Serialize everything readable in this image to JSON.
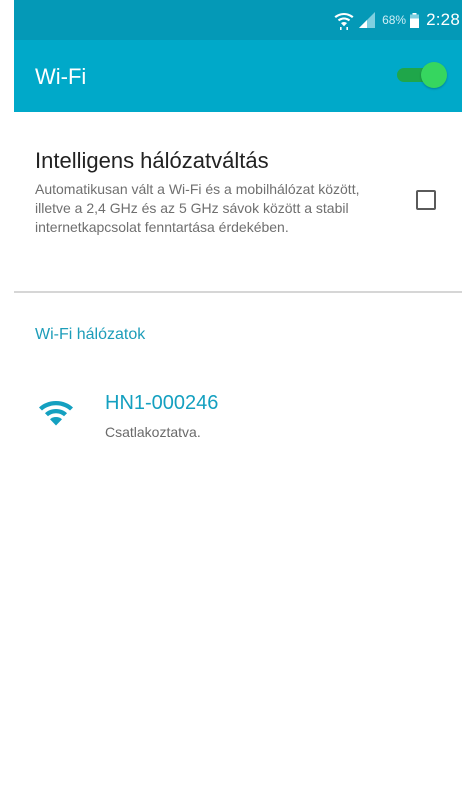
{
  "status_bar": {
    "battery_percent": "68%",
    "time": "2:28",
    "icons": [
      "wifi-icon",
      "cellular-signal-icon",
      "battery-icon"
    ]
  },
  "action_bar": {
    "title": "Wi-Fi",
    "toggle": {
      "state": "on",
      "color": "#36d65f"
    }
  },
  "smart_switch": {
    "title": "Intelligens hálózatváltás",
    "description": "Automatikusan vált a Wi-Fi és a mobilhálózat között, illetve a 2,4 GHz és az 5 GHz sávok között a stabil internetkapcsolat fenntartása érdekében.",
    "checked": false
  },
  "networks_section": {
    "header": "Wi-Fi hálózatok",
    "items": [
      {
        "name": "HN1-000246",
        "status": "Csatlakoztatva.",
        "icon": "wifi-signal-full-icon"
      }
    ]
  },
  "colors": {
    "status_bar_bg": "#0499b7",
    "action_bar_bg": "#00a9c9",
    "accent": "#14a0c0",
    "switch_on": "#36d65f"
  }
}
